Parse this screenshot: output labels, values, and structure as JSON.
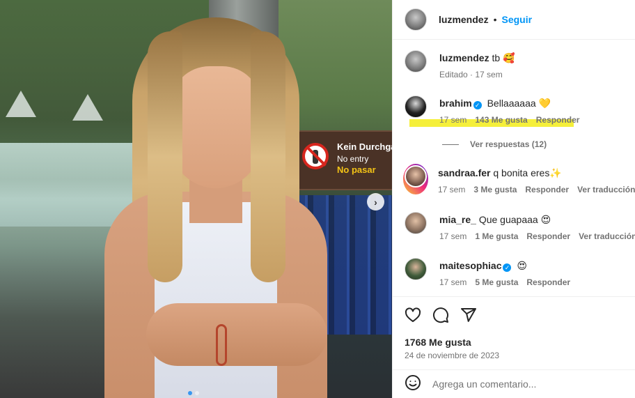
{
  "post": {
    "author": "luzmendez",
    "follow_label": "Seguir",
    "separator": "•",
    "caption_text": "tb 🥰",
    "caption_meta": "Editado · 17 sem",
    "likes": "1768 Me gusta",
    "date": "24 de noviembre de 2023",
    "carousel": {
      "slides": 2,
      "active": 1
    }
  },
  "photo_sign": {
    "line1": "Kein Durchgang",
    "line2": "No entry",
    "line3": "No pasar"
  },
  "comments": [
    {
      "user": "brahim",
      "verified": true,
      "text": "Bellaaaaaa 💛",
      "time": "17 sem",
      "likes": "143 Me gusta",
      "reply": "Responder",
      "view_replies": "Ver respuestas (12)"
    },
    {
      "user": "sandraa.fer",
      "verified": false,
      "text": "q bonita eres✨",
      "time": "17 sem",
      "likes": "3 Me gusta",
      "reply": "Responder",
      "translate": "Ver traducción"
    },
    {
      "user": "mia_re_",
      "verified": false,
      "text": "Que guapaaa 😍",
      "time": "17 sem",
      "likes": "1 Me gusta",
      "reply": "Responder",
      "translate": "Ver traducción"
    },
    {
      "user": "maitesophiac",
      "verified": true,
      "text": "😍",
      "time": "17 sem",
      "likes": "5 Me gusta",
      "reply": "Responder"
    }
  ],
  "add_comment": {
    "placeholder": "Agrega un comentario..."
  },
  "icons": {
    "like": "heart-icon",
    "comment": "comment-icon",
    "share": "send-icon",
    "emoji": "emoji-icon",
    "next": "chevron-right-icon",
    "verified": "verified-badge-icon"
  },
  "colors": {
    "accent": "#0095f6",
    "highlight": "#f5ef3a",
    "muted": "#737373",
    "text": "#262626"
  }
}
